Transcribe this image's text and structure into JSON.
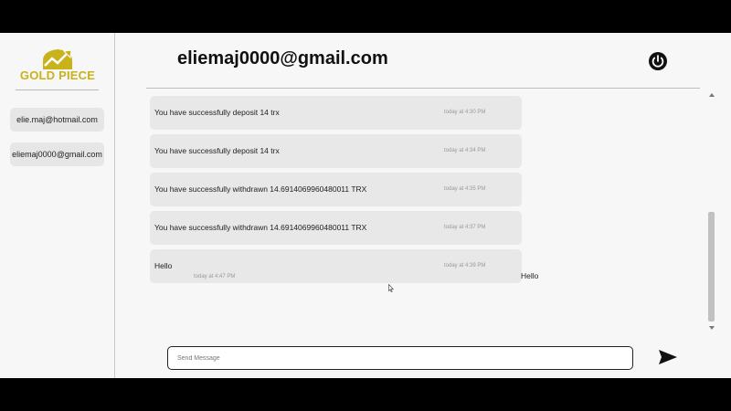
{
  "sidebar": {
    "logo_text": "GOLD PIECE",
    "contacts": [
      {
        "label": "elie.maj@hotmail.com"
      },
      {
        "label": "eliemaj0000@gmail.com"
      }
    ]
  },
  "header": {
    "title": "eliemaj0000@gmail.com",
    "power_icon": "power-icon"
  },
  "messages": [
    {
      "text": "You have successfully deposit 14 trx",
      "time": "today at 4:30 PM"
    },
    {
      "text": "You have successfully deposit 14 trx",
      "time": "today at 4:34 PM"
    },
    {
      "text": "You have successfully withdrawn 14.6914069960480011 TRX",
      "time": "today at 4:35 PM"
    },
    {
      "text": "You have successfully withdrawn 14.6914069960480011 TRX",
      "time": "today at 4:37 PM"
    },
    {
      "text": "Hello",
      "time": "today at 4:39 PM"
    }
  ],
  "outgoing": {
    "text": "Hello",
    "time": "today at 4:47 PM"
  },
  "composer": {
    "placeholder": "Send Message",
    "send_icon": "send-icon"
  },
  "colors": {
    "brand_gold": "#c9b21a",
    "bubble_bg": "#e8e8e8",
    "page_bg": "#f7f7f7"
  }
}
